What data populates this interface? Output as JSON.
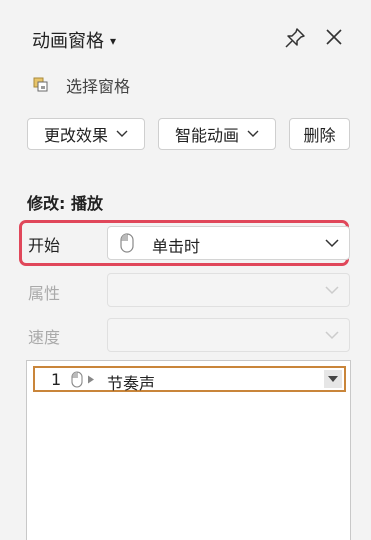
{
  "header": {
    "title": "动画窗格",
    "pin_icon": "pin-icon",
    "close_icon": "close-icon"
  },
  "selection_pane": {
    "label": "选择窗格",
    "icon": "selection-pane-icon"
  },
  "toolbar": {
    "change_effect": "更改效果",
    "smart_animation": "智能动画",
    "delete": "删除"
  },
  "modify": {
    "label": "修改: 播放",
    "start": {
      "label": "开始",
      "value": "单击时"
    },
    "property": {
      "label": "属性",
      "value": ""
    },
    "speed": {
      "label": "速度",
      "value": ""
    }
  },
  "animation_list": [
    {
      "index": "1",
      "trigger_icon": "mouse-icon",
      "name": "节奏声"
    }
  ],
  "colors": {
    "highlight": "#e0475a",
    "item_border": "#c9853a"
  }
}
